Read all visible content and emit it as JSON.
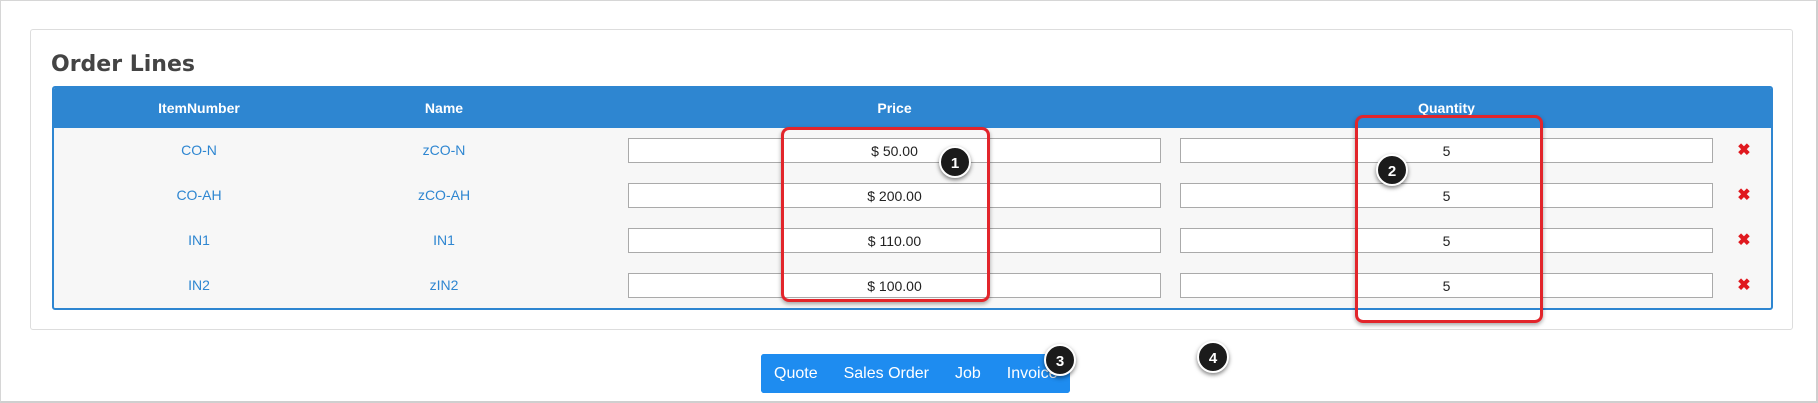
{
  "panel": {
    "title": "Order Lines"
  },
  "table": {
    "headers": {
      "item_number": "ItemNumber",
      "name": "Name",
      "price": "Price",
      "quantity": "Quantity"
    },
    "rows": [
      {
        "item_number": "CO-N",
        "name": "zCO-N",
        "price": "$ 50.00",
        "quantity": "5"
      },
      {
        "item_number": "CO-AH",
        "name": "zCO-AH",
        "price": "$ 200.00",
        "quantity": "5"
      },
      {
        "item_number": "IN1",
        "name": "IN1",
        "price": "$ 110.00",
        "quantity": "5"
      },
      {
        "item_number": "IN2",
        "name": "zIN2",
        "price": "$ 100.00",
        "quantity": "5"
      }
    ],
    "delete_icon": "✖"
  },
  "actions": {
    "quote": "Quote",
    "sales_order": "Sales Order",
    "job": "Job",
    "invoice": "Invoice"
  },
  "annotations": {
    "badge_1": "1",
    "badge_2": "2",
    "badge_3": "3",
    "badge_4": "4"
  },
  "icons": {
    "delete": "close-x-icon"
  },
  "colors": {
    "accent": "#2e86d1",
    "button": "#1e8cf0",
    "delete": "#e0191f",
    "highlight": "#e2252b",
    "badge": "#1b1b1b"
  }
}
